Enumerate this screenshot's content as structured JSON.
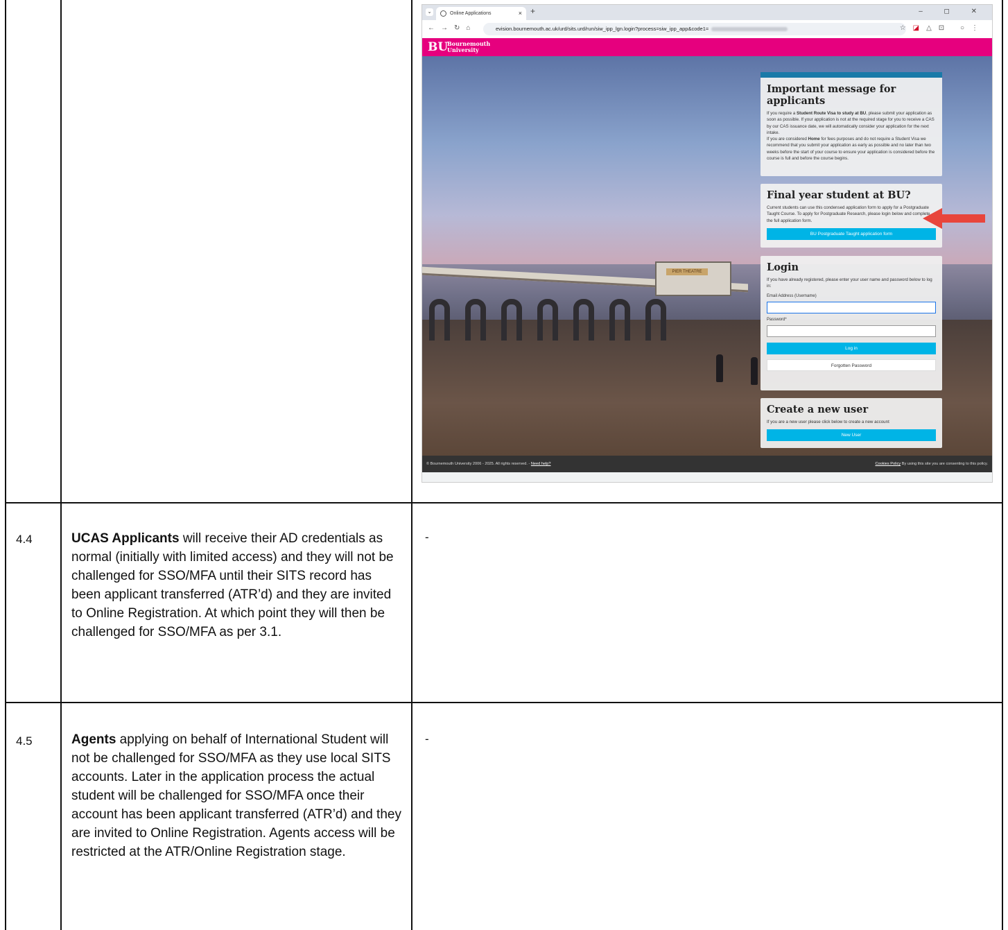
{
  "browser": {
    "tab_title": "Online Applications",
    "tab_close": "×",
    "new_tab": "+",
    "url": "evision.bournemouth.ac.uk/urd/sits.urd/run/siw_ipp_lgn.login?process=siw_ipp_app&code1=",
    "window_controls": "–  ◻  ✕"
  },
  "site": {
    "logo": "BU",
    "name_line1": "Bournemouth",
    "name_line2": "University"
  },
  "important_panel": {
    "title": "Important message for applicants",
    "p1_a": "If you require a ",
    "p1_bold": "Student Route Visa to study at BU",
    "p1_b": ", please submit your application as soon as possible. If your application is not at the required stage for you to receive a CAS by our CAS issuance date, we will automatically consider your application for the next intake.",
    "p2_a": "If you are considered ",
    "p2_bold": "Home",
    "p2_b": " for fees purposes and do not require a Student Visa we recommend that you submit your application as early as possible and no later than two weeks before the start of your course to ensure your application is considered before the course is full and before the course begins."
  },
  "final_year_panel": {
    "title": "Final year student at BU?",
    "text": "Current students can use this condensed application form to apply for a Postgraduate Taught Course. To apply for Postgraduate Research, please login below and complete the full application form.",
    "button": "BU Postgraduate Taught application form"
  },
  "login_panel": {
    "title": "Login",
    "text": "If you have already registered, please enter your user name and password below to log in:",
    "email_label": "Email Address (Username)",
    "password_label": "Password*",
    "login_button": "Log in",
    "forgot_button": "Forgotten Password"
  },
  "create_panel": {
    "title": "Create a new user",
    "text": "If you are a new user please click below to create a new account",
    "button": "New User"
  },
  "footer": {
    "left": "© Bournemouth University 2006 - 2025. All rights reserved. - ",
    "help_link": "Need help?",
    "cookies_link": "Cookies Policy",
    "right": " By using this site you are consenting to this policy."
  },
  "pier_sign": "PIER THEATRE",
  "rows": [
    {
      "number": "4.4",
      "bold": "UCAS Applicants",
      "text": " will receive their AD credentials as normal (initially with limited access) and they will not be challenged for SSO/MFA until their SITS record has been applicant transferred (ATR’d) and they are invited to Online Registration.  At which point they will then be challenged for SSO/MFA as per 3.1.",
      "right": "-"
    },
    {
      "number": "4.5",
      "bold": "Agents",
      "text": " applying on behalf of International Student will not be challenged for SSO/MFA as they use local SITS accounts.  Later in the application process the actual student will be challenged for SSO/MFA once their account has been applicant transferred (ATR’d) and they are invited to Online Registration.  Agents access will be restricted at the ATR/Online Registration stage.",
      "right": "-"
    }
  ],
  "colors": {
    "brand_pink": "#e6007e",
    "button_blue": "#00b4e6",
    "arrow_red": "#e8453c"
  }
}
